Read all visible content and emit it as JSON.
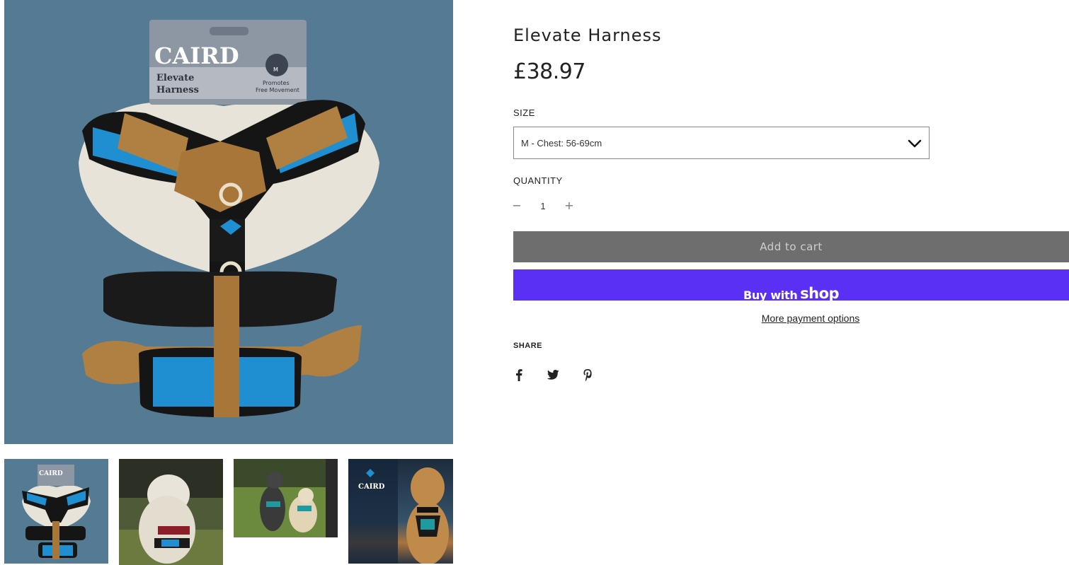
{
  "gallery": {
    "main_image": {
      "brand": "CAIRD",
      "product_line1": "Elevate",
      "product_line2": "Harness",
      "size_badge": "M",
      "tagline1": "Promotes",
      "tagline2": "Free Movement",
      "alt": "harness-on-card-image"
    },
    "thumbnails": [
      {
        "name": "thumb-harness-card",
        "brand": "CAIRD"
      },
      {
        "name": "thumb-white-dog"
      },
      {
        "name": "thumb-two-dogs"
      },
      {
        "name": "thumb-labrador",
        "brand": "CAIRD"
      }
    ]
  },
  "product": {
    "title": "Elevate Harness",
    "price": "£38.97"
  },
  "options": {
    "size_label": "SIZE",
    "size_selected": "M - Chest: 56-69cm",
    "quantity_label": "QUANTITY",
    "quantity_value": "1",
    "minus_symbol": "−",
    "plus_symbol": "+"
  },
  "actions": {
    "add_to_cart": "Add to cart",
    "buy_with": "Buy with",
    "shop_logo": "shop",
    "more_payment": "More payment options"
  },
  "share": {
    "label": "SHARE",
    "icons": [
      "facebook-icon",
      "twitter-icon",
      "pinterest-icon"
    ]
  },
  "colors": {
    "add_to_cart_bg": "#6e6e6e",
    "shop_pay_bg": "#5a31f4",
    "main_image_bg": "#557a94"
  }
}
